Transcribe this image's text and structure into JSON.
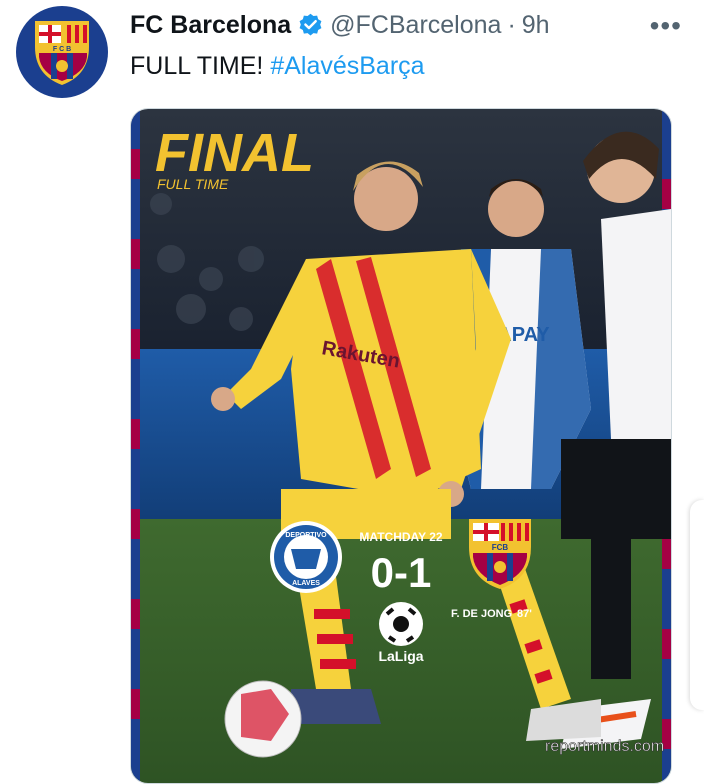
{
  "tweet": {
    "author_name": "FC Barcelona",
    "handle": "@FCBarcelona",
    "separator": "·",
    "time": "9h",
    "more_label": "•••",
    "text": "FULL TIME! ",
    "hashtag": "#AlavésBarça",
    "avatar_icon": "fcb-crest-icon",
    "verified_icon": "verified-badge-icon"
  },
  "graphic": {
    "headline": "FINAL",
    "subhead": "FULL TIME",
    "matchday": "MATCHDAY 22",
    "score": "0-1",
    "home_crest_text": "DEPORTIVO",
    "home_crest_subtext": "ALAVES",
    "away_crest_text": "FCB",
    "scorer": "F. DE JONG",
    "scorer_minute": "87'",
    "league": "LaLiga",
    "sponsor_text": "Rakuten",
    "shirt_text": "ØTAPAY",
    "watermark": "reportminds.com"
  },
  "colors": {
    "accent_blue": "#1d9bf0",
    "barca_blue": "#1b3f8f",
    "barca_red": "#a50044",
    "gold": "#f2c230",
    "kit_yellow": "#f6d23c"
  }
}
